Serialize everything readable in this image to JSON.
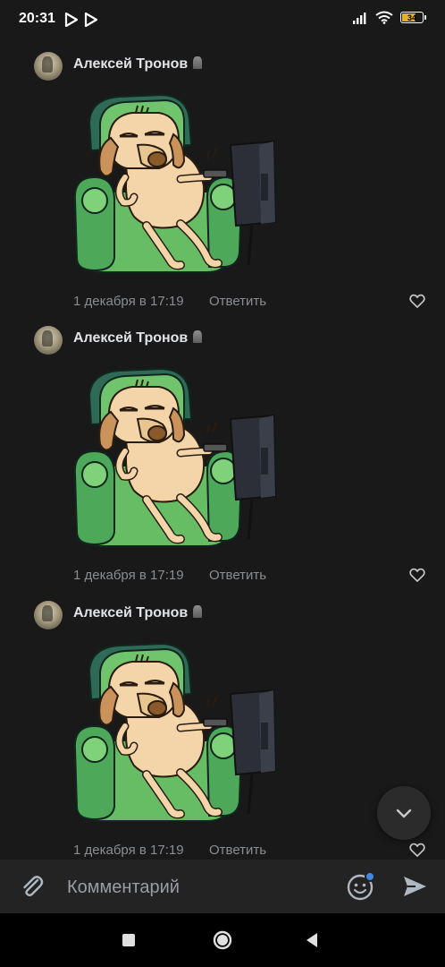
{
  "status_bar": {
    "time": "20:31",
    "battery": "34",
    "icons": [
      "play-store-icon",
      "play-store-icon",
      "signal-icon",
      "wifi-icon",
      "battery-icon"
    ]
  },
  "comments": [
    {
      "author": "Алексей Тронов",
      "date": "1 декабря в 17:19",
      "reply_label": "Ответить",
      "sticker": "dog-in-armchair-watching-tv-sticker"
    },
    {
      "author": "Алексей Тронов",
      "date": "1 декабря в 17:19",
      "reply_label": "Ответить",
      "sticker": "dog-in-armchair-watching-tv-sticker"
    },
    {
      "author": "Алексей Тронов",
      "date": "1 декабря в 17:19",
      "reply_label": "Ответить",
      "sticker": "dog-in-armchair-watching-tv-sticker"
    }
  ],
  "composer": {
    "placeholder": "Комментарий",
    "value": ""
  },
  "colors": {
    "background": "#191919",
    "input_bar": "#232323",
    "text_primary": "#e1e3e6",
    "text_secondary": "#8a8d91",
    "emoji_badge": "#3f8ae0",
    "battery": "#e5b12b"
  }
}
